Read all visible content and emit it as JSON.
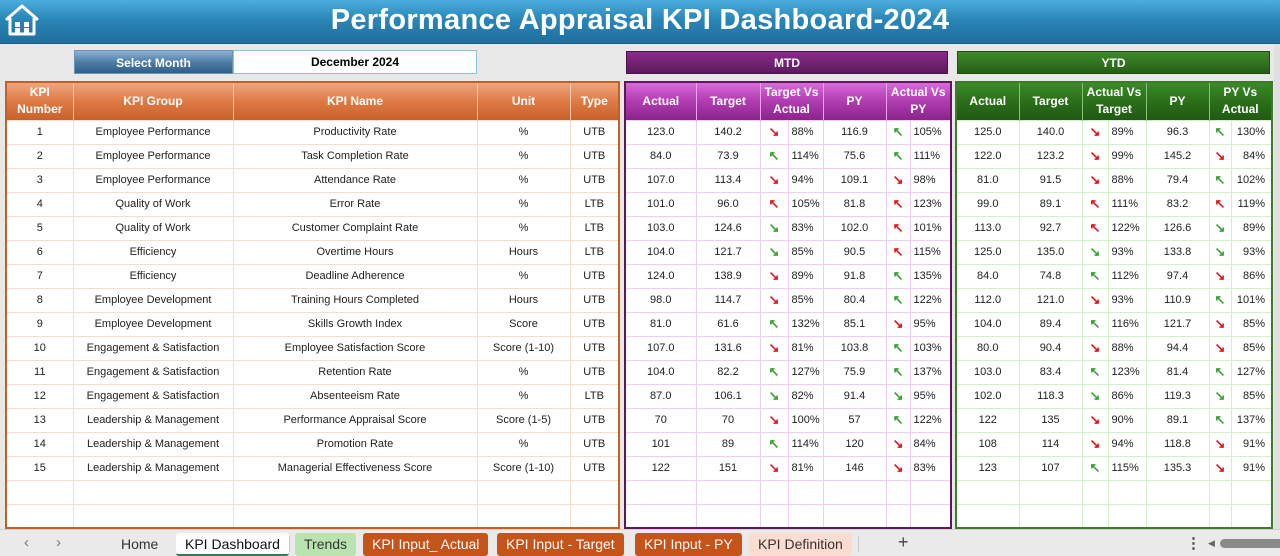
{
  "header": {
    "title": "Performance Appraisal KPI Dashboard-2024",
    "home_icon": "home-icon"
  },
  "month_selector": {
    "label": "Select Month",
    "value": "December 2024"
  },
  "sections": {
    "mtd": "MTD",
    "ytd": "YTD"
  },
  "kpi_table": {
    "headers": [
      "KPI Number",
      "KPI Group",
      "KPI Name",
      "Unit",
      "Type"
    ],
    "rows": [
      {
        "num": "1",
        "group": "Employee Performance",
        "name": "Productivity Rate",
        "unit": "%",
        "type": "UTB"
      },
      {
        "num": "2",
        "group": "Employee Performance",
        "name": "Task Completion Rate",
        "unit": "%",
        "type": "UTB"
      },
      {
        "num": "3",
        "group": "Employee Performance",
        "name": "Attendance Rate",
        "unit": "%",
        "type": "UTB"
      },
      {
        "num": "4",
        "group": "Quality of Work",
        "name": "Error Rate",
        "unit": "%",
        "type": "LTB"
      },
      {
        "num": "5",
        "group": "Quality of Work",
        "name": "Customer Complaint Rate",
        "unit": "%",
        "type": "LTB"
      },
      {
        "num": "6",
        "group": "Efficiency",
        "name": "Overtime Hours",
        "unit": "Hours",
        "type": "LTB"
      },
      {
        "num": "7",
        "group": "Efficiency",
        "name": "Deadline Adherence",
        "unit": "%",
        "type": "UTB"
      },
      {
        "num": "8",
        "group": "Employee Development",
        "name": "Training Hours Completed",
        "unit": "Hours",
        "type": "UTB"
      },
      {
        "num": "9",
        "group": "Employee Development",
        "name": "Skills Growth Index",
        "unit": "Score",
        "type": "UTB"
      },
      {
        "num": "10",
        "group": "Engagement & Satisfaction",
        "name": "Employee Satisfaction Score",
        "unit": "Score (1-10)",
        "type": "UTB"
      },
      {
        "num": "11",
        "group": "Engagement & Satisfaction",
        "name": "Retention Rate",
        "unit": "%",
        "type": "UTB"
      },
      {
        "num": "12",
        "group": "Engagement & Satisfaction",
        "name": "Absenteeism Rate",
        "unit": "%",
        "type": "LTB"
      },
      {
        "num": "13",
        "group": "Leadership & Management",
        "name": "Performance Appraisal Score",
        "unit": "Score (1-5)",
        "type": "UTB"
      },
      {
        "num": "14",
        "group": "Leadership & Management",
        "name": "Promotion Rate",
        "unit": "%",
        "type": "UTB"
      },
      {
        "num": "15",
        "group": "Leadership & Management",
        "name": "Managerial Effectiveness Score",
        "unit": "Score (1-10)",
        "type": "UTB"
      }
    ]
  },
  "mtd_table": {
    "headers": [
      "Actual",
      "Target",
      "Target Vs Actual",
      "PY",
      "Actual Vs PY"
    ],
    "rows": [
      {
        "actual": "123.0",
        "target": "140.2",
        "tva_dir": "down",
        "tva_color": "red",
        "tva": "88%",
        "py": "116.9",
        "avp_dir": "up",
        "avp_color": "green",
        "avp": "105%"
      },
      {
        "actual": "84.0",
        "target": "73.9",
        "tva_dir": "up",
        "tva_color": "green",
        "tva": "114%",
        "py": "75.6",
        "avp_dir": "up",
        "avp_color": "green",
        "avp": "111%"
      },
      {
        "actual": "107.0",
        "target": "113.4",
        "tva_dir": "down",
        "tva_color": "red",
        "tva": "94%",
        "py": "109.1",
        "avp_dir": "down",
        "avp_color": "red",
        "avp": "98%"
      },
      {
        "actual": "101.0",
        "target": "96.0",
        "tva_dir": "up",
        "tva_color": "red",
        "tva": "105%",
        "py": "81.8",
        "avp_dir": "up",
        "avp_color": "red",
        "avp": "123%"
      },
      {
        "actual": "103.0",
        "target": "124.6",
        "tva_dir": "down",
        "tva_color": "green",
        "tva": "83%",
        "py": "102.0",
        "avp_dir": "up",
        "avp_color": "red",
        "avp": "101%"
      },
      {
        "actual": "104.0",
        "target": "121.7",
        "tva_dir": "down",
        "tva_color": "green",
        "tva": "85%",
        "py": "90.5",
        "avp_dir": "up",
        "avp_color": "red",
        "avp": "115%"
      },
      {
        "actual": "124.0",
        "target": "138.9",
        "tva_dir": "down",
        "tva_color": "red",
        "tva": "89%",
        "py": "91.8",
        "avp_dir": "up",
        "avp_color": "green",
        "avp": "135%"
      },
      {
        "actual": "98.0",
        "target": "114.7",
        "tva_dir": "down",
        "tva_color": "red",
        "tva": "85%",
        "py": "80.4",
        "avp_dir": "up",
        "avp_color": "green",
        "avp": "122%"
      },
      {
        "actual": "81.0",
        "target": "61.6",
        "tva_dir": "up",
        "tva_color": "green",
        "tva": "132%",
        "py": "85.1",
        "avp_dir": "down",
        "avp_color": "red",
        "avp": "95%"
      },
      {
        "actual": "107.0",
        "target": "131.6",
        "tva_dir": "down",
        "tva_color": "red",
        "tva": "81%",
        "py": "103.8",
        "avp_dir": "up",
        "avp_color": "green",
        "avp": "103%"
      },
      {
        "actual": "104.0",
        "target": "82.2",
        "tva_dir": "up",
        "tva_color": "green",
        "tva": "127%",
        "py": "75.9",
        "avp_dir": "up",
        "avp_color": "green",
        "avp": "137%"
      },
      {
        "actual": "87.0",
        "target": "106.1",
        "tva_dir": "down",
        "tva_color": "green",
        "tva": "82%",
        "py": "91.4",
        "avp_dir": "down",
        "avp_color": "green",
        "avp": "95%"
      },
      {
        "actual": "70",
        "target": "70",
        "tva_dir": "down",
        "tva_color": "red",
        "tva": "100%",
        "py": "57",
        "avp_dir": "up",
        "avp_color": "green",
        "avp": "122%"
      },
      {
        "actual": "101",
        "target": "89",
        "tva_dir": "up",
        "tva_color": "green",
        "tva": "114%",
        "py": "120",
        "avp_dir": "down",
        "avp_color": "red",
        "avp": "84%"
      },
      {
        "actual": "122",
        "target": "151",
        "tva_dir": "down",
        "tva_color": "red",
        "tva": "81%",
        "py": "146",
        "avp_dir": "down",
        "avp_color": "red",
        "avp": "83%"
      }
    ]
  },
  "ytd_table": {
    "headers": [
      "Actual",
      "Target",
      "Actual Vs Target",
      "PY",
      "PY Vs Actual"
    ],
    "rows": [
      {
        "actual": "125.0",
        "target": "140.0",
        "tva_dir": "down",
        "tva_color": "red",
        "tva": "89%",
        "py": "96.3",
        "avp_dir": "up",
        "avp_color": "green",
        "avp": "130%"
      },
      {
        "actual": "122.0",
        "target": "123.2",
        "tva_dir": "down",
        "tva_color": "red",
        "tva": "99%",
        "py": "145.2",
        "avp_dir": "down",
        "avp_color": "red",
        "avp": "84%"
      },
      {
        "actual": "81.0",
        "target": "91.5",
        "tva_dir": "down",
        "tva_color": "red",
        "tva": "88%",
        "py": "79.4",
        "avp_dir": "up",
        "avp_color": "green",
        "avp": "102%"
      },
      {
        "actual": "99.0",
        "target": "89.1",
        "tva_dir": "up",
        "tva_color": "red",
        "tva": "111%",
        "py": "83.2",
        "avp_dir": "up",
        "avp_color": "red",
        "avp": "119%"
      },
      {
        "actual": "113.0",
        "target": "92.7",
        "tva_dir": "up",
        "tva_color": "red",
        "tva": "122%",
        "py": "126.6",
        "avp_dir": "down",
        "avp_color": "green",
        "avp": "89%"
      },
      {
        "actual": "125.0",
        "target": "135.0",
        "tva_dir": "down",
        "tva_color": "green",
        "tva": "93%",
        "py": "133.8",
        "avp_dir": "down",
        "avp_color": "green",
        "avp": "93%"
      },
      {
        "actual": "84.0",
        "target": "74.8",
        "tva_dir": "up",
        "tva_color": "green",
        "tva": "112%",
        "py": "97.4",
        "avp_dir": "down",
        "avp_color": "red",
        "avp": "86%"
      },
      {
        "actual": "112.0",
        "target": "121.0",
        "tva_dir": "down",
        "tva_color": "red",
        "tva": "93%",
        "py": "110.9",
        "avp_dir": "up",
        "avp_color": "green",
        "avp": "101%"
      },
      {
        "actual": "104.0",
        "target": "89.4",
        "tva_dir": "up",
        "tva_color": "green",
        "tva": "116%",
        "py": "121.7",
        "avp_dir": "down",
        "avp_color": "red",
        "avp": "85%"
      },
      {
        "actual": "80.0",
        "target": "90.4",
        "tva_dir": "down",
        "tva_color": "red",
        "tva": "88%",
        "py": "94.4",
        "avp_dir": "down",
        "avp_color": "red",
        "avp": "85%"
      },
      {
        "actual": "103.0",
        "target": "83.4",
        "tva_dir": "up",
        "tva_color": "green",
        "tva": "123%",
        "py": "81.4",
        "avp_dir": "up",
        "avp_color": "green",
        "avp": "127%"
      },
      {
        "actual": "102.0",
        "target": "118.3",
        "tva_dir": "down",
        "tva_color": "green",
        "tva": "86%",
        "py": "119.3",
        "avp_dir": "down",
        "avp_color": "green",
        "avp": "85%"
      },
      {
        "actual": "122",
        "target": "135",
        "tva_dir": "down",
        "tva_color": "red",
        "tva": "90%",
        "py": "89.1",
        "avp_dir": "up",
        "avp_color": "green",
        "avp": "137%"
      },
      {
        "actual": "108",
        "target": "114",
        "tva_dir": "down",
        "tva_color": "red",
        "tva": "94%",
        "py": "118.8",
        "avp_dir": "down",
        "avp_color": "red",
        "avp": "91%"
      },
      {
        "actual": "123",
        "target": "107",
        "tva_dir": "up",
        "tva_color": "green",
        "tva": "115%",
        "py": "135.3",
        "avp_dir": "down",
        "avp_color": "red",
        "avp": "91%"
      }
    ]
  },
  "status_colors": {
    "good": "#3aa035",
    "bad": "#e0161e"
  },
  "sheet_tabs": [
    {
      "label": "Home",
      "style": "home"
    },
    {
      "label": "KPI Dashboard",
      "style": "active"
    },
    {
      "label": "Trends",
      "style": "trends"
    },
    {
      "label": "KPI Input_ Actual",
      "style": "orange"
    },
    {
      "label": "KPI Input - Target",
      "style": "orange"
    },
    {
      "label": "KPI Input - PY",
      "style": "orange"
    },
    {
      "label": "KPI Definition",
      "style": "peach"
    }
  ],
  "sheetbar": {
    "prev": "‹",
    "next": "›",
    "add": "+",
    "more": "⋮"
  }
}
